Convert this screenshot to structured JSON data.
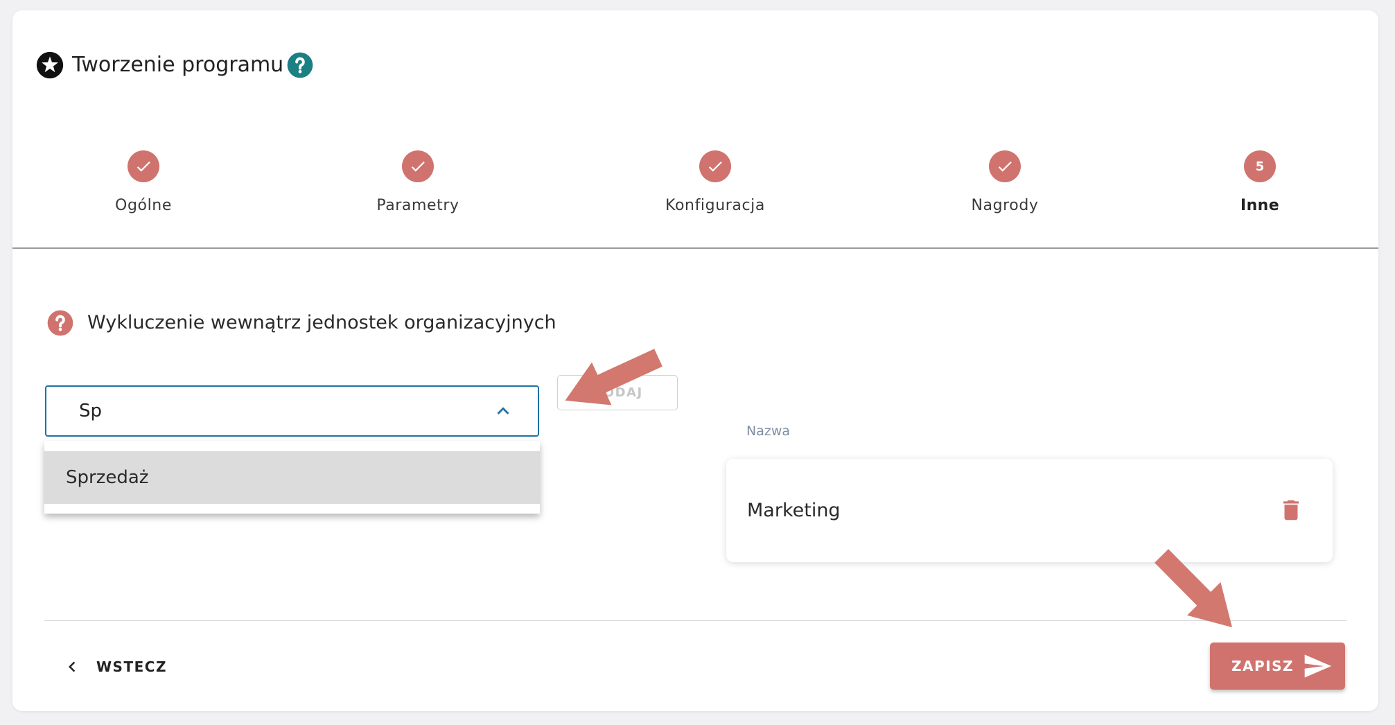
{
  "header": {
    "title": "Tworzenie programu",
    "title_icon": "star-circle-icon",
    "help_icon": "help-circle-icon"
  },
  "stepper": {
    "steps": [
      {
        "label": "Ogólne",
        "icon": "check-icon"
      },
      {
        "label": "Parametry",
        "icon": "check-icon"
      },
      {
        "label": "Konfiguracja",
        "icon": "check-icon"
      },
      {
        "label": "Nagrody",
        "icon": "check-icon"
      },
      {
        "label": "Inne",
        "number": "5",
        "active": true
      }
    ]
  },
  "exclusion": {
    "label": "Wykluczenie wewnątrz jednostek organizacyjnych",
    "help_icon": "help-circle-icon",
    "input_value": "Sp",
    "toggle_icon": "chevron-up-icon",
    "dropdown_open": true,
    "dropdown_options": [
      "Sprzedaż"
    ],
    "highlighted_option": 0,
    "add_button": "DODAJ",
    "add_button_disabled": true
  },
  "table": {
    "column_header": "Nazwa",
    "rows": [
      {
        "name": "Marketing",
        "action_icon": "trash-icon"
      }
    ]
  },
  "footer": {
    "back_label": "WSTECZ",
    "back_icon": "chevron-left-icon",
    "save_label": "ZAPISZ",
    "save_icon": "send-icon"
  },
  "colors": {
    "accent": "#d0736e",
    "help": "#1b7f83",
    "input_border": "#1e72a6",
    "annotation": "#d2786f"
  }
}
